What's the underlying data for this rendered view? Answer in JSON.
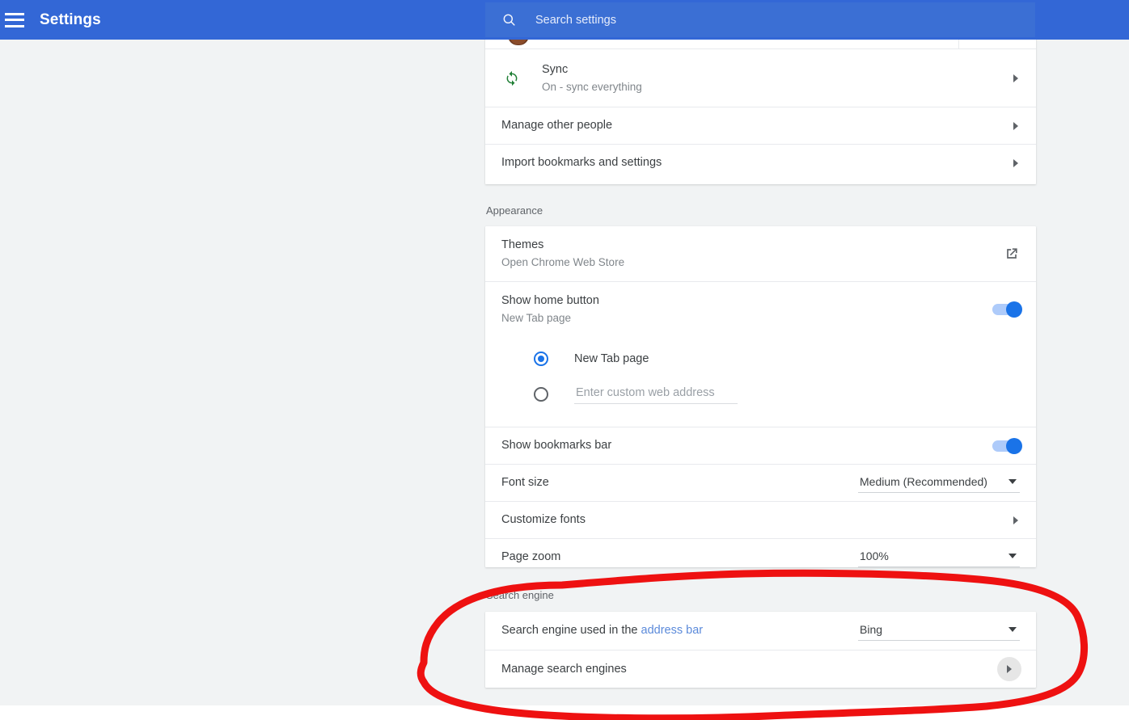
{
  "header": {
    "menu_icon": "hamburger-menu-icon",
    "title": "Settings",
    "search": {
      "icon": "search-icon",
      "placeholder": "Search settings",
      "value": ""
    }
  },
  "people_card": {
    "rows": [
      {
        "icon": "sync-icon",
        "title": "Sync",
        "subtitle": "On - sync everything",
        "trailing": "chevron-right-icon"
      },
      {
        "title": "Manage other people",
        "subtitle": "",
        "trailing": "chevron-right-icon"
      },
      {
        "title": "Import bookmarks and settings",
        "subtitle": "",
        "trailing": "chevron-right-icon"
      }
    ]
  },
  "appearance": {
    "section_label": "Appearance",
    "themes": {
      "title": "Themes",
      "subtitle": "Open Chrome Web Store",
      "trailing": "open-in-new-icon"
    },
    "show_home_button": {
      "title": "Show home button",
      "subtitle": "New Tab page",
      "toggle_on": true
    },
    "home_options": {
      "new_tab": {
        "label": "New Tab page",
        "selected": true
      },
      "custom": {
        "placeholder": "Enter custom web address",
        "value": "",
        "selected": false
      }
    },
    "show_bookmarks_bar": {
      "title": "Show bookmarks bar",
      "toggle_on": true
    },
    "font_size": {
      "title": "Font size",
      "value": "Medium (Recommended)"
    },
    "customize_fonts": {
      "title": "Customize fonts",
      "trailing": "chevron-right-icon"
    },
    "page_zoom": {
      "title": "Page zoom",
      "value": "100%"
    }
  },
  "search_engine": {
    "section_label": "Search engine",
    "address_bar_row": {
      "title_prefix": "Search engine used in the ",
      "title_link": "address bar",
      "value": "Bing"
    },
    "manage_row": {
      "title": "Manage search engines",
      "trailing": "chevron-right-icon"
    }
  },
  "annotation": {
    "shape": "hand-drawn-oval-highlight",
    "color": "#ee1111"
  },
  "colors": {
    "header_blue": "#3367d6",
    "search_blue": "#3b6fd4",
    "accent_blue": "#1a73e8",
    "track_blue": "#aecbfa",
    "page_bg": "#f1f3f4",
    "card_bg": "#ffffff",
    "text_primary": "#3c4043",
    "text_secondary": "#80868b",
    "link_blue": "#5b8ada",
    "sync_green": "#1e7e34",
    "annotation_red": "#ee1111"
  }
}
